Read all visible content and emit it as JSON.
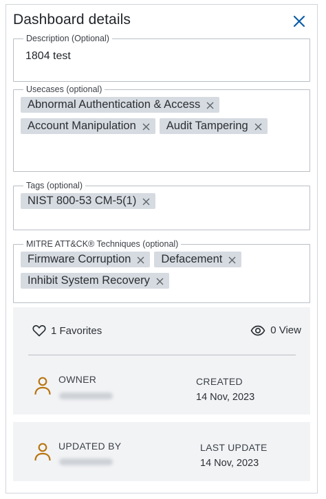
{
  "panel": {
    "title": "Dashboard details",
    "close_icon": "close-icon"
  },
  "description": {
    "label": "Description (Optional)",
    "value": "1804 test"
  },
  "usecases": {
    "label": "Usecases (optional)",
    "items": [
      "Abnormal Authentication & Access",
      "Account Manipulation",
      "Audit Tampering"
    ]
  },
  "tags": {
    "label": "Tags (optional)",
    "items": [
      "NIST 800-53 CM-5(1)"
    ]
  },
  "mitre": {
    "label": "MITRE ATT&CK® Techniques (optional)",
    "items": [
      "Firmware Corruption",
      "Defacement",
      "Inhibit System Recovery"
    ]
  },
  "stats": {
    "favorites": "1 Favorites",
    "views": "0 View"
  },
  "owner": {
    "label": "OWNER",
    "created_label": "CREATED",
    "created_value": "14 Nov, 2023"
  },
  "updated": {
    "label": "UPDATED BY",
    "last_update_label": "LAST UPDATE",
    "last_update_value": "14 Nov, 2023"
  },
  "colors": {
    "accent": "#0b5ca8",
    "chip_bg": "#d6dbe1",
    "person_icon": "#b8750e"
  }
}
